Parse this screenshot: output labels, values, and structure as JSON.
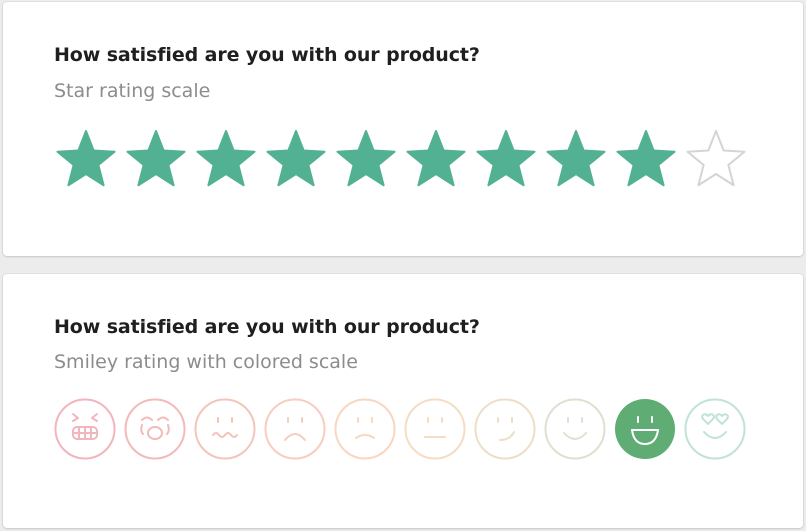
{
  "rating_cards": [
    {
      "question": "How satisfied are you with our product?",
      "subtitle": "Star rating scale",
      "type": "stars",
      "max": 10,
      "selected": 9,
      "colors": {
        "filled": "#52b192",
        "empty_stroke": "#d4d4d4"
      }
    },
    {
      "question": "How satisfied are you with our product?",
      "subtitle": "Smiley rating with colored scale",
      "type": "smiley",
      "max": 10,
      "selected": 9,
      "colors": {
        "selected_fill": "#5fac75"
      },
      "smileys": [
        {
          "icon": "grimace-icon",
          "color": "#f2b5bd"
        },
        {
          "icon": "crying-icon",
          "color": "#f2bab9"
        },
        {
          "icon": "queasy-icon",
          "color": "#f4c4bb"
        },
        {
          "icon": "frown-icon",
          "color": "#f6cdbf"
        },
        {
          "icon": "slight-frown-icon",
          "color": "#f8d6c0"
        },
        {
          "icon": "neutral-icon",
          "color": "#f7dcc4"
        },
        {
          "icon": "smirk-icon",
          "color": "#ecdfc6"
        },
        {
          "icon": "smile-icon",
          "color": "#e0e0d0"
        },
        {
          "icon": "grin-icon",
          "color": "#5fac75"
        },
        {
          "icon": "heart-eyes-icon",
          "color": "#bfe3d4"
        }
      ]
    }
  ]
}
